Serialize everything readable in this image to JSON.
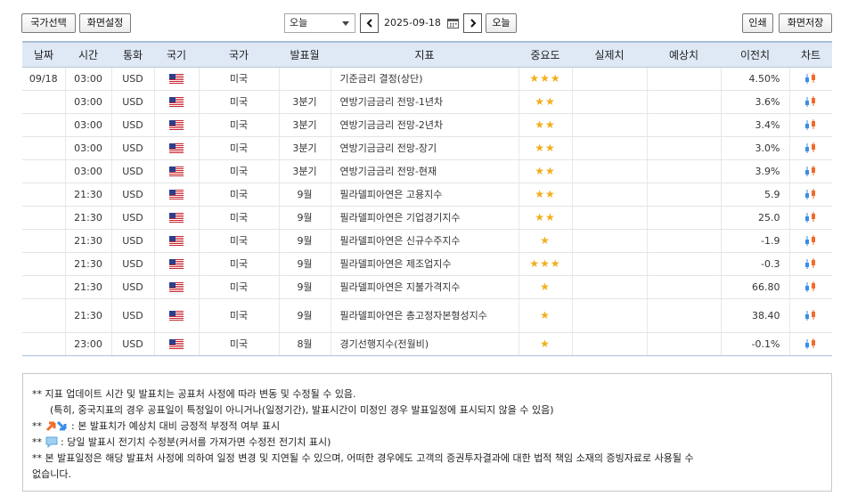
{
  "toolbar": {
    "country_select": "국가선택",
    "screen_settings": "화면설정",
    "day_select": "오늘",
    "date": "2025-09-18",
    "today": "오늘",
    "print": "인쇄",
    "save_screen": "화면저장"
  },
  "columns": [
    "날짜",
    "시간",
    "통화",
    "국기",
    "국가",
    "발표월",
    "지표",
    "중요도",
    "실제치",
    "예상치",
    "이전치",
    "차트"
  ],
  "rows": [
    {
      "date": "09/18",
      "time": "03:00",
      "currency": "USD",
      "country": "미국",
      "month": "",
      "indicator": "기준금리 결정(상단)",
      "stars": "★★★",
      "actual": "",
      "forecast": "",
      "previous": "4.50%"
    },
    {
      "date": "",
      "time": "03:00",
      "currency": "USD",
      "country": "미국",
      "month": "3분기",
      "indicator": "연방기금금리 전망-1년차",
      "stars": "★★",
      "actual": "",
      "forecast": "",
      "previous": "3.6%"
    },
    {
      "date": "",
      "time": "03:00",
      "currency": "USD",
      "country": "미국",
      "month": "3분기",
      "indicator": "연방기금금리 전망-2년차",
      "stars": "★★",
      "actual": "",
      "forecast": "",
      "previous": "3.4%"
    },
    {
      "date": "",
      "time": "03:00",
      "currency": "USD",
      "country": "미국",
      "month": "3분기",
      "indicator": "연방기금금리 전망-장기",
      "stars": "★★",
      "actual": "",
      "forecast": "",
      "previous": "3.0%"
    },
    {
      "date": "",
      "time": "03:00",
      "currency": "USD",
      "country": "미국",
      "month": "3분기",
      "indicator": "연방기금금리 전망-현재",
      "stars": "★★",
      "actual": "",
      "forecast": "",
      "previous": "3.9%"
    },
    {
      "date": "",
      "time": "21:30",
      "currency": "USD",
      "country": "미국",
      "month": "9월",
      "indicator": "필라델피아연은 고용지수",
      "stars": "★★",
      "actual": "",
      "forecast": "",
      "previous": "5.9"
    },
    {
      "date": "",
      "time": "21:30",
      "currency": "USD",
      "country": "미국",
      "month": "9월",
      "indicator": "필라델피아연은 기업경기지수",
      "stars": "★★",
      "actual": "",
      "forecast": "",
      "previous": "25.0"
    },
    {
      "date": "",
      "time": "21:30",
      "currency": "USD",
      "country": "미국",
      "month": "9월",
      "indicator": "필라델피아연은 신규수주지수",
      "stars": "★",
      "actual": "",
      "forecast": "",
      "previous": "-1.9"
    },
    {
      "date": "",
      "time": "21:30",
      "currency": "USD",
      "country": "미국",
      "month": "9월",
      "indicator": "필라델피아연은 제조업지수",
      "stars": "★★★",
      "actual": "",
      "forecast": "",
      "previous": "-0.3"
    },
    {
      "date": "",
      "time": "21:30",
      "currency": "USD",
      "country": "미국",
      "month": "9월",
      "indicator": "필라델피아연은 지불가격지수",
      "stars": "★",
      "actual": "",
      "forecast": "",
      "previous": "66.80"
    },
    {
      "date": "",
      "time": "21:30",
      "currency": "USD",
      "country": "미국",
      "month": "9월",
      "indicator": "필라델피아연은 총고정자본형성지수",
      "stars": "★",
      "actual": "",
      "forecast": "",
      "previous": "38.40",
      "tall": true
    },
    {
      "date": "",
      "time": "23:00",
      "currency": "USD",
      "country": "미국",
      "month": "8월",
      "indicator": "경기선행지수(전월비)",
      "stars": "★",
      "actual": "",
      "forecast": "",
      "previous": "-0.1%"
    }
  ],
  "notes": {
    "line1": "** 지표 업데이트 시간 및 발표치는 공표처 사정에 따라 변동 및 수정될 수 있음.",
    "line2": "(특히, 중국지표의 경우 공표일이 특정일이 아니거나(일정기간), 발표시간이 미정인 경우 발표일정에 표시되지 않을 수 있음)",
    "line3_prefix": "** ",
    "line3": " : 본 발표치가 예상치 대비 긍정적 부정적 여부 표시",
    "line4_prefix": "** ",
    "line4": " : 당일 발표시 전기치 수정분(커서를 가져가면 수정전 전기치 표시)",
    "line5": "** 본 발표일정은 해당 발표처 사정에 의하여 일정 변경 및 지연될 수 있으며, 어떠한 경우에도 고객의 증권투자결과에 대한 법적 책임 소재의 증빙자료로 사용될 수",
    "line6": "없습니다."
  },
  "colors": {
    "header_bg": "#dfe9f5",
    "star": "#f2ae1c",
    "up": "#f26a2a",
    "down": "#3a8ee6"
  }
}
